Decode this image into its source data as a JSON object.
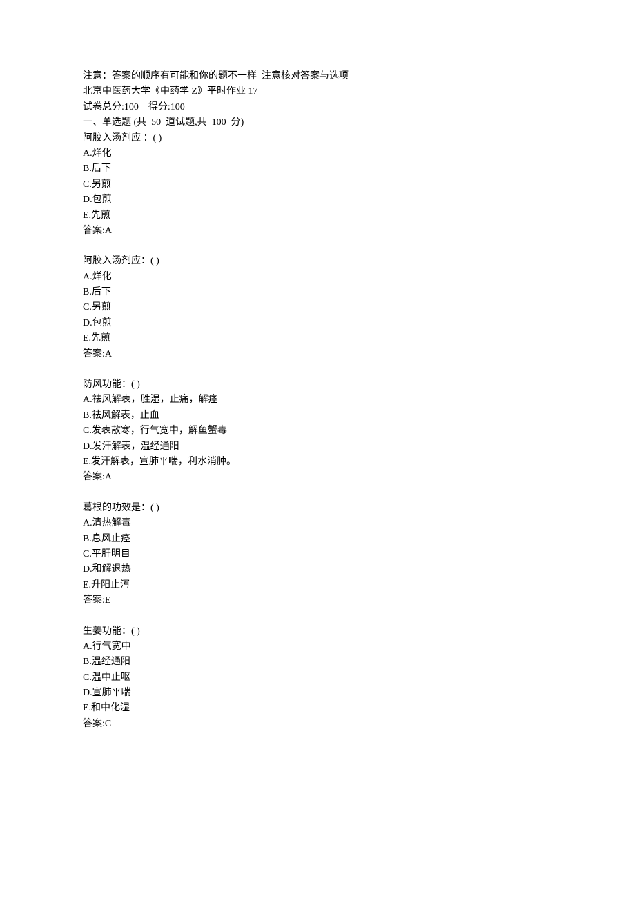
{
  "header": {
    "notice": "注意：答案的顺序有可能和你的题不一样  注意核对答案与选项",
    "school_course": "北京中医药大学《中药学 Z》平时作业 17",
    "score_info": "试卷总分:100    得分:100",
    "section_title": "一、单选题 (共  50  道试题,共  100  分)"
  },
  "questions": [
    {
      "stem": "阿胶入汤剂应 ：( )",
      "options": [
        "A.烊化",
        "B.后下",
        "C.另煎",
        "D.包煎",
        "E.先煎"
      ],
      "answer": "答案:A"
    },
    {
      "stem": "阿胶入汤剂应：( )",
      "options": [
        "A.烊化",
        "B.后下",
        "C.另煎",
        "D.包煎",
        "E.先煎"
      ],
      "answer": "答案:A"
    },
    {
      "stem": "防风功能：( )",
      "options": [
        "A.祛风解表，胜湿，止痛，解痉",
        "B.祛风解表，止血",
        "C.发表散寒，行气宽中，解鱼蟹毒",
        "D.发汗解表，温经通阳",
        "E.发汗解表，宣肺平喘，利水消肿。"
      ],
      "answer": "答案:A"
    },
    {
      "stem": "葛根的功效是：( )",
      "options": [
        "A.清热解毒",
        "B.息风止痉",
        "C.平肝明目",
        "D.和解退热",
        "E.升阳止泻"
      ],
      "answer": "答案:E"
    },
    {
      "stem": "生姜功能：( )",
      "options": [
        "A.行气宽中",
        "B.温经通阳",
        "C.温中止呕",
        "D.宣肺平喘",
        "E.和中化湿"
      ],
      "answer": "答案:C"
    }
  ]
}
